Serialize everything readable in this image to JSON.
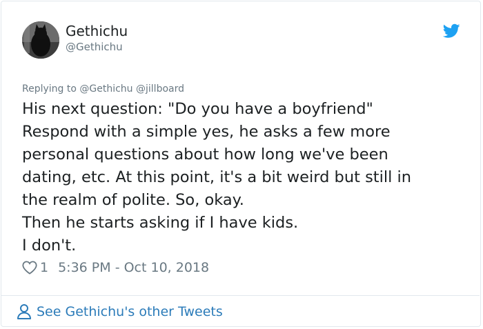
{
  "author": {
    "display_name": "Gethichu",
    "handle": "@Gethichu"
  },
  "reply_context": {
    "prefix": "Replying to",
    "mentions": [
      "@Gethichu",
      "@jillboard"
    ]
  },
  "tweet": {
    "lines": [
      "His next question: \"Do you have a boyfriend\"",
      "Respond with a simple yes, he asks a few more",
      "personal questions about how long we've been",
      "dating, etc. At this point, it's a bit weird but still in",
      "the realm of polite. So, okay.",
      "Then he starts asking if I have kids.",
      "I don't."
    ],
    "like_count": "1",
    "timestamp": "5:36 PM - Oct 10, 2018"
  },
  "footer": {
    "link_label": "See Gethichu's other Tweets"
  },
  "colors": {
    "twitter_blue": "#1da1f2",
    "link_blue": "#2b7bb9",
    "muted_gray": "#697882",
    "text_dark": "#1c2022",
    "border": "#e1e8ed"
  },
  "icons": {
    "brand": "twitter-bird-icon",
    "like": "heart-icon",
    "profile": "person-icon"
  }
}
